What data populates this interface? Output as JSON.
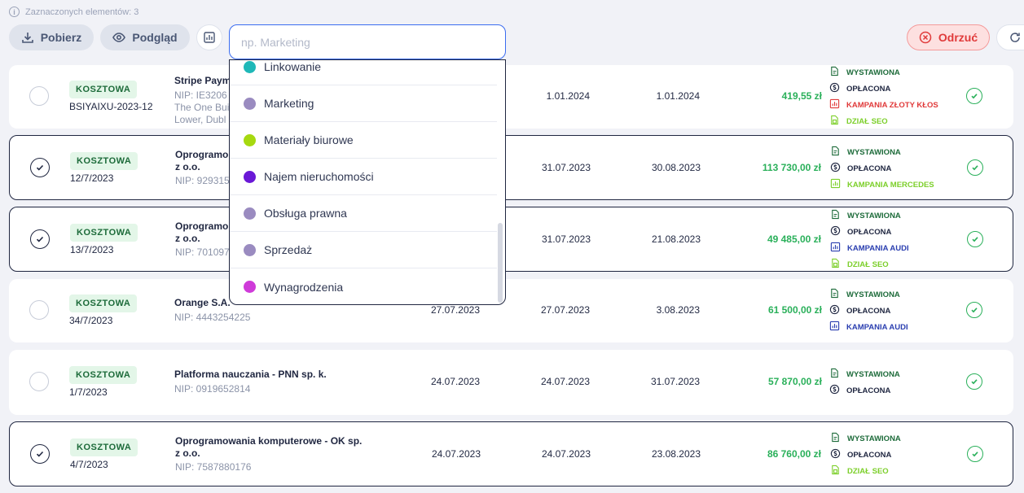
{
  "selection_info": "Zaznaczonych elementów: 3",
  "toolbar": {
    "download_label": "Pobierz",
    "preview_label": "Podgląd",
    "reject_label": "Odrzuć"
  },
  "search": {
    "placeholder": "np. Marketing",
    "value": ""
  },
  "dropdown": {
    "items": [
      {
        "label": "Linkowanie",
        "color": "#1fb8b8"
      },
      {
        "label": "Marketing",
        "color": "#9a8bc0"
      },
      {
        "label": "Materiały biurowe",
        "color": "#a6d90f"
      },
      {
        "label": "Najem nieruchomości",
        "color": "#6a18d6"
      },
      {
        "label": "Obsługa prawna",
        "color": "#9a8bc0"
      },
      {
        "label": "Sprzedaż",
        "color": "#9a8bc0"
      },
      {
        "label": "Wynagrodzenia",
        "color": "#cf3bd9"
      }
    ]
  },
  "rows": [
    {
      "selected": false,
      "type": "KOSZTOWA",
      "doc": "BSIYAIXU-2023-12",
      "company": "Stripe Paym",
      "nip": "NIP: IE3206",
      "address": [
        "The One Bui",
        "Lower, Dubl"
      ],
      "date1": "",
      "date2": "1.01.2024",
      "date3": "1.01.2024",
      "amount": "419,55 zł",
      "tags": [
        {
          "label": "WYSTAWIONA",
          "kind": "doc",
          "color": "#1d6b3a"
        },
        {
          "label": "OPŁACONA",
          "kind": "coin",
          "color": "#1f2640"
        },
        {
          "label": "KAMPANIA ZŁOTY KŁOS",
          "kind": "chart",
          "color": "#e03a3a"
        },
        {
          "label": "DZIAŁ SEO",
          "kind": "calc",
          "color": "#7ccf2a"
        }
      ]
    },
    {
      "selected": true,
      "type": "KOSZTOWA",
      "doc": "12/7/2023",
      "company": "Oprogramo",
      "company2": "z o.o.",
      "nip": "NIP: 929315",
      "date1": "",
      "date2": "31.07.2023",
      "date3": "30.08.2023",
      "amount": "113 730,00 zł",
      "tags": [
        {
          "label": "WYSTAWIONA",
          "kind": "doc",
          "color": "#1d6b3a"
        },
        {
          "label": "OPŁACONA",
          "kind": "coin",
          "color": "#1f2640"
        },
        {
          "label": "KAMPANIA MERCEDES",
          "kind": "chart",
          "color": "#7ccf2a"
        }
      ]
    },
    {
      "selected": true,
      "type": "KOSZTOWA",
      "doc": "13/7/2023",
      "company": "Oprogramo",
      "company2": "z o.o.",
      "nip": "NIP: 701097",
      "date1": "",
      "date2": "31.07.2023",
      "date3": "21.08.2023",
      "amount": "49 485,00 zł",
      "tags": [
        {
          "label": "WYSTAWIONA",
          "kind": "doc",
          "color": "#1d6b3a"
        },
        {
          "label": "OPŁACONA",
          "kind": "coin",
          "color": "#1f2640"
        },
        {
          "label": "KAMPANIA AUDI",
          "kind": "chart",
          "color": "#2b3fb0"
        },
        {
          "label": "DZIAŁ SEO",
          "kind": "calc",
          "color": "#7ccf2a"
        }
      ]
    },
    {
      "selected": false,
      "type": "KOSZTOWA",
      "doc": "34/7/2023",
      "company": "Orange S.A.",
      "nip": "NIP: 4443254225",
      "date1": "27.07.2023",
      "date2": "27.07.2023",
      "date3": "3.08.2023",
      "amount": "61 500,00 zł",
      "tags": [
        {
          "label": "WYSTAWIONA",
          "kind": "doc",
          "color": "#1d6b3a"
        },
        {
          "label": "OPŁACONA",
          "kind": "coin",
          "color": "#1f2640"
        },
        {
          "label": "KAMPANIA AUDI",
          "kind": "chart",
          "color": "#2b3fb0"
        }
      ]
    },
    {
      "selected": false,
      "type": "KOSZTOWA",
      "doc": "1/7/2023",
      "company": "Platforma nauczania - PNN sp. k.",
      "nip": "NIP: 0919652814",
      "date1": "24.07.2023",
      "date2": "24.07.2023",
      "date3": "31.07.2023",
      "amount": "57 870,00 zł",
      "tags": [
        {
          "label": "WYSTAWIONA",
          "kind": "doc",
          "color": "#1d6b3a"
        },
        {
          "label": "OPŁACONA",
          "kind": "coin",
          "color": "#1f2640"
        }
      ]
    },
    {
      "selected": true,
      "type": "KOSZTOWA",
      "doc": "4/7/2023",
      "company": "Oprogramowania komputerowe - OK sp.",
      "company2": "z o.o.",
      "nip": "NIP: 7587880176",
      "date1": "24.07.2023",
      "date2": "24.07.2023",
      "date3": "23.08.2023",
      "amount": "86 760,00 zł",
      "tags": [
        {
          "label": "WYSTAWIONA",
          "kind": "doc",
          "color": "#1d6b3a"
        },
        {
          "label": "OPŁACONA",
          "kind": "coin",
          "color": "#1f2640"
        },
        {
          "label": "DZIAŁ SEO",
          "kind": "calc",
          "color": "#7ccf2a"
        }
      ]
    }
  ]
}
